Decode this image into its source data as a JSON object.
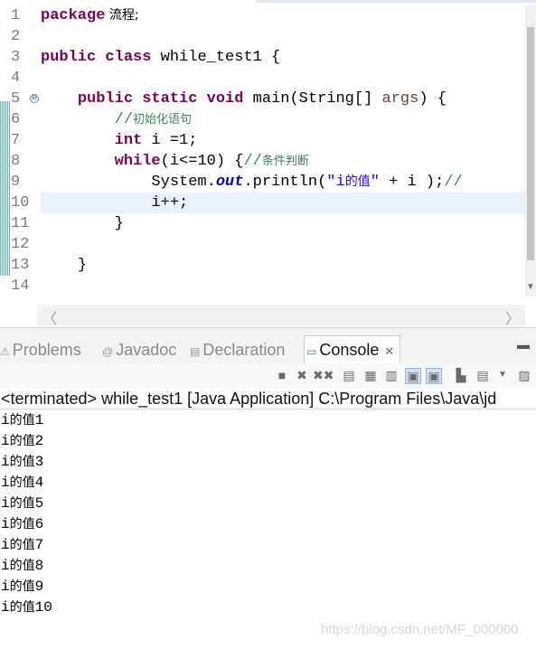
{
  "editor": {
    "line_numbers": [
      "1",
      "2",
      "3",
      "4",
      "5",
      "6",
      "7",
      "8",
      "9",
      "10",
      "11",
      "12",
      "13",
      "14"
    ],
    "fold_marker": "⊖",
    "lines": {
      "l1": {
        "kw": "package",
        "rest": " 流程;"
      },
      "l3": {
        "kw1": "public",
        "kw2": "class",
        "rest": " while_test1 {"
      },
      "l5": {
        "indent": "    ",
        "kw1": "public",
        "kw2": "static",
        "kw3": "void",
        "name": " main(String[] ",
        "param": "args",
        "rest": ") {"
      },
      "l6": {
        "indent": "        ",
        "comment_prefix": "//",
        "comment_text": "初始化语句"
      },
      "l7": {
        "indent": "        ",
        "kw": "int",
        "rest": " i =1;"
      },
      "l8": {
        "indent": "        ",
        "kw": "while",
        "rest": "(i<=10) {",
        "comment_prefix": "//",
        "comment_text": "条件判断"
      },
      "l9": {
        "indent": "            ",
        "pre": "System.",
        "field": "out",
        "call": ".println(",
        "str_q1": "\"i",
        "str_zh": "的值",
        "str_q2": "\"",
        "rest": " + i );",
        "comment": "//"
      },
      "l10": {
        "indent": "            ",
        "text": "i++;"
      },
      "l11": {
        "indent": "        ",
        "text": "}"
      },
      "l13": {
        "indent": "    ",
        "text": "}"
      }
    },
    "scroll_left": "〈",
    "scroll_right": "〉",
    "scroll_down": "▼"
  },
  "views": {
    "tabs": [
      {
        "label": "Problems",
        "icon": "⚠"
      },
      {
        "label": "Javadoc",
        "icon": "@"
      },
      {
        "label": "Declaration",
        "icon": "▤"
      },
      {
        "label": "Console",
        "icon": "▭",
        "close": "✕"
      }
    ],
    "minimize": "▬",
    "toolbar_icons": {
      "stop": "■",
      "remove": "✖",
      "remove_all": "✖✖",
      "clear": "▤",
      "scroll_lock": "▦",
      "word_wrap": "▥",
      "show_on_out": "▣",
      "show_on_err": "▣",
      "pin": "▙",
      "display": "▤",
      "menu": "▼",
      "new_console": "▨"
    }
  },
  "console": {
    "status": "<terminated> while_test1 [Java Application] C:\\Program Files\\Java\\jd",
    "output": [
      {
        "a": "i",
        "zh": "的值",
        "n": "1"
      },
      {
        "a": "i",
        "zh": "的值",
        "n": "2"
      },
      {
        "a": "i",
        "zh": "的值",
        "n": "3"
      },
      {
        "a": "i",
        "zh": "的值",
        "n": "4"
      },
      {
        "a": "i",
        "zh": "的值",
        "n": "5"
      },
      {
        "a": "i",
        "zh": "的值",
        "n": "6"
      },
      {
        "a": "i",
        "zh": "的值",
        "n": "7"
      },
      {
        "a": "i",
        "zh": "的值",
        "n": "8"
      },
      {
        "a": "i",
        "zh": "的值",
        "n": "9"
      },
      {
        "a": "i",
        "zh": "的值",
        "n": "10"
      }
    ]
  },
  "watermark": "https://blog.csdn.net/MF_000000"
}
